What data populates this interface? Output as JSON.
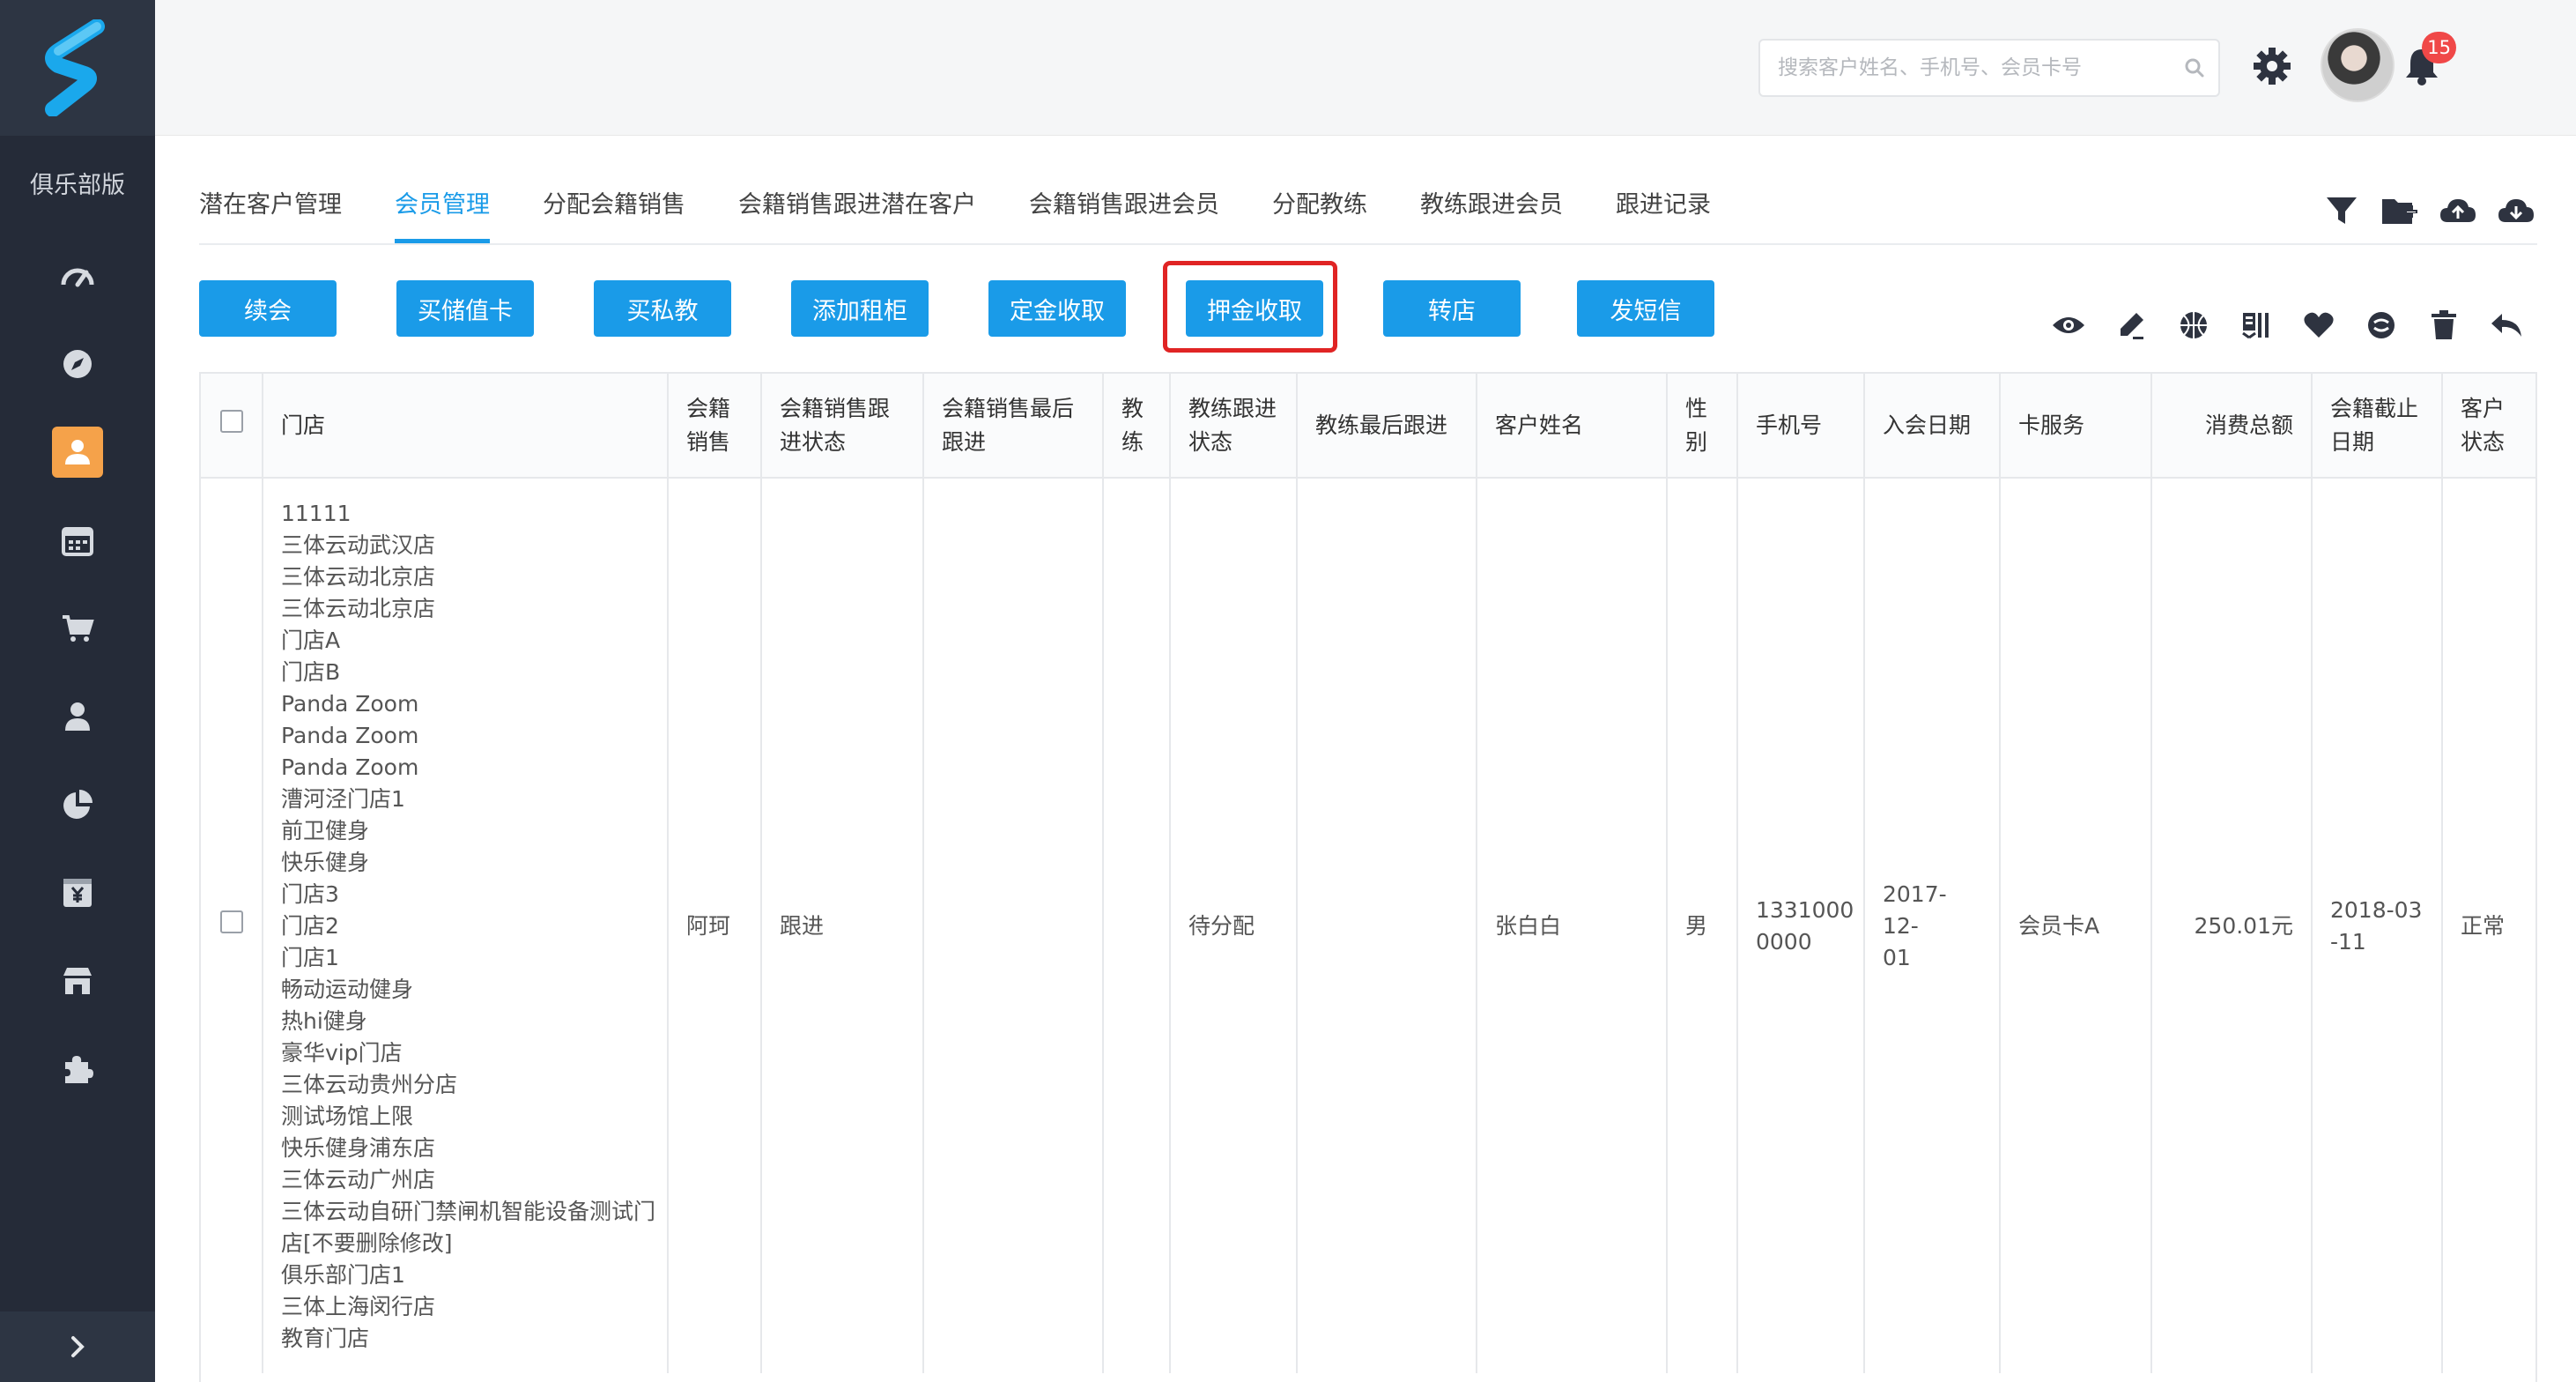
{
  "sidebar": {
    "club_label": "俱乐部版",
    "items": [
      {
        "icon": "dashboard-icon"
      },
      {
        "icon": "compass-icon"
      },
      {
        "icon": "member-icon",
        "active": true
      },
      {
        "icon": "calendar-icon"
      },
      {
        "icon": "cart-icon"
      },
      {
        "icon": "user-icon"
      },
      {
        "icon": "pie-chart-icon"
      },
      {
        "icon": "finance-icon"
      },
      {
        "icon": "store-icon"
      },
      {
        "icon": "puzzle-icon"
      }
    ]
  },
  "topbar": {
    "search_placeholder": "搜索客户姓名、手机号、会员卡号",
    "notification_count": "15"
  },
  "tabs": [
    {
      "label": "潜在客户管理",
      "active": false
    },
    {
      "label": "会员管理",
      "active": true
    },
    {
      "label": "分配会籍销售",
      "active": false
    },
    {
      "label": "会籍销售跟进潜在客户",
      "active": false
    },
    {
      "label": "会籍销售跟进会员",
      "active": false
    },
    {
      "label": "分配教练",
      "active": false
    },
    {
      "label": "教练跟进会员",
      "active": false
    },
    {
      "label": "跟进记录",
      "active": false
    }
  ],
  "actions": [
    {
      "label": "续会"
    },
    {
      "label": "买储值卡"
    },
    {
      "label": "买私教"
    },
    {
      "label": "添加租柜"
    },
    {
      "label": "定金收取"
    },
    {
      "label": "押金收取",
      "highlighted": true
    },
    {
      "label": "转店"
    },
    {
      "label": "发短信"
    }
  ],
  "table": {
    "headers": [
      "门店",
      "会籍销售",
      "会籍销售跟进状态",
      "会籍销售最后跟进",
      "教练",
      "教练跟进状态",
      "教练最后跟进",
      "客户姓名",
      "性别",
      "手机号",
      "入会日期",
      "卡服务",
      "消费总额",
      "会籍截止日期",
      "客户状态"
    ],
    "rows": [
      {
        "stores": [
          "11111",
          "三体云动武汉店",
          "三体云动北京店",
          "三体云动北京店",
          "门店A",
          "门店B",
          "Panda Zoom",
          "Panda Zoom",
          "Panda Zoom",
          "漕河泾门店1",
          "前卫健身",
          "快乐健身",
          "门店3",
          "门店2",
          "门店1",
          "畅动运动健身",
          "热hi健身",
          "豪华vip门店",
          "三体云动贵州分店",
          "测试场馆上限",
          "快乐健身浦东店",
          "三体云动广州店",
          "三体云动自研门禁闸机智能设备测试门",
          "店[不要删除修改]",
          "俱乐部门店1",
          "三体上海闵行店",
          "教育门店"
        ],
        "sales": "阿珂",
        "sales_status": "跟进",
        "sales_last": "",
        "coach": "",
        "coach_status": "待分配",
        "coach_last": "",
        "name": "张白白",
        "gender": "男",
        "phone": "1331000\n0000",
        "join_date": "2017-12-\n01",
        "card": "会员卡A",
        "total": "250.01元",
        "expire": "2018-03\n-11",
        "status": "正常"
      }
    ]
  },
  "colors": {
    "primary": "#1a9be8",
    "sidebar": "#252b38",
    "active_nav": "#f5a24a",
    "highlight": "#e02424",
    "badge": "#f04848"
  }
}
